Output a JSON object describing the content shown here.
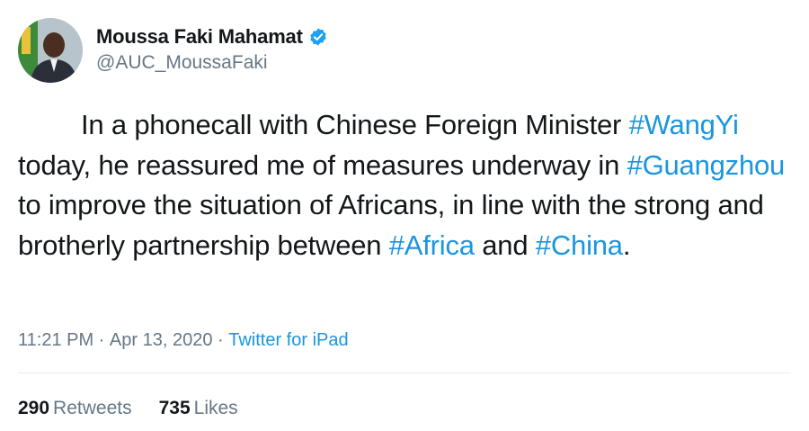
{
  "author": {
    "name": "Moussa Faki Mahamat",
    "handle": "@AUC_MoussaFaki",
    "verified": true,
    "verified_color": "#1da1f2"
  },
  "tweet": {
    "segments": [
      {
        "text": "In a phonecall with Chinese Foreign Minister ",
        "hashtag": false
      },
      {
        "text": "#WangYi",
        "hashtag": true
      },
      {
        "text": " today, he reassured me of measures underway in ",
        "hashtag": false
      },
      {
        "text": "#Guangzhou",
        "hashtag": true
      },
      {
        "text": " to improve the situation of Africans, in line with the strong and brotherly partnership between ",
        "hashtag": false
      },
      {
        "text": "#Africa",
        "hashtag": true
      },
      {
        "text": " and ",
        "hashtag": false
      },
      {
        "text": "#China",
        "hashtag": true
      },
      {
        "text": ".",
        "hashtag": false
      }
    ]
  },
  "meta": {
    "time": "11:21 PM",
    "separator": " · ",
    "date": "Apr 13, 2020",
    "source": "Twitter for iPad"
  },
  "stats": {
    "retweets_count": "290",
    "retweets_label": "Retweets",
    "likes_count": "735",
    "likes_label": "Likes"
  },
  "colors": {
    "link": "#1b95e0",
    "text": "#14171a",
    "muted": "#657786"
  }
}
